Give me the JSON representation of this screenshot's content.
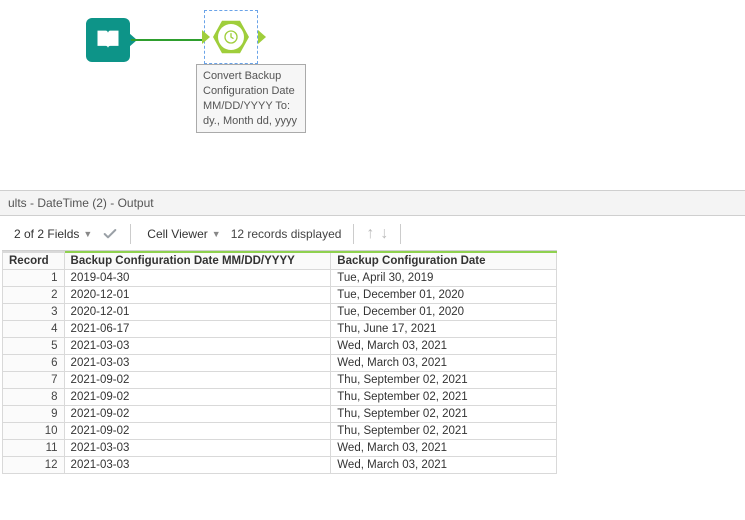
{
  "workflow": {
    "input_node_name": "input-tool",
    "datetime_node_name": "datetime-tool",
    "node_label": "Convert Backup Configuration Date MM/DD/YYYY To: dy., Month dd, yyyy"
  },
  "results": {
    "panel_title": "ults - DateTime (2) - Output",
    "fields_label": "2 of 2 Fields",
    "cell_viewer_label": "Cell Viewer",
    "records_label": "12 records displayed"
  },
  "table": {
    "columns": {
      "record": "Record",
      "col1": "Backup Configuration Date MM/DD/YYYY",
      "col2": "Backup Configuration Date"
    },
    "rows": [
      {
        "n": "1",
        "a": "2019-04-30",
        "b": "Tue, April 30, 2019"
      },
      {
        "n": "2",
        "a": "2020-12-01",
        "b": "Tue, December 01, 2020"
      },
      {
        "n": "3",
        "a": "2020-12-01",
        "b": "Tue, December 01, 2020"
      },
      {
        "n": "4",
        "a": "2021-06-17",
        "b": "Thu, June 17, 2021"
      },
      {
        "n": "5",
        "a": "2021-03-03",
        "b": "Wed, March 03, 2021"
      },
      {
        "n": "6",
        "a": "2021-03-03",
        "b": "Wed, March 03, 2021"
      },
      {
        "n": "7",
        "a": "2021-09-02",
        "b": "Thu, September 02, 2021"
      },
      {
        "n": "8",
        "a": "2021-09-02",
        "b": "Thu, September 02, 2021"
      },
      {
        "n": "9",
        "a": "2021-09-02",
        "b": "Thu, September 02, 2021"
      },
      {
        "n": "10",
        "a": "2021-09-02",
        "b": "Thu, September 02, 2021"
      },
      {
        "n": "11",
        "a": "2021-03-03",
        "b": "Wed, March 03, 2021"
      },
      {
        "n": "12",
        "a": "2021-03-03",
        "b": "Wed, March 03, 2021"
      }
    ]
  }
}
